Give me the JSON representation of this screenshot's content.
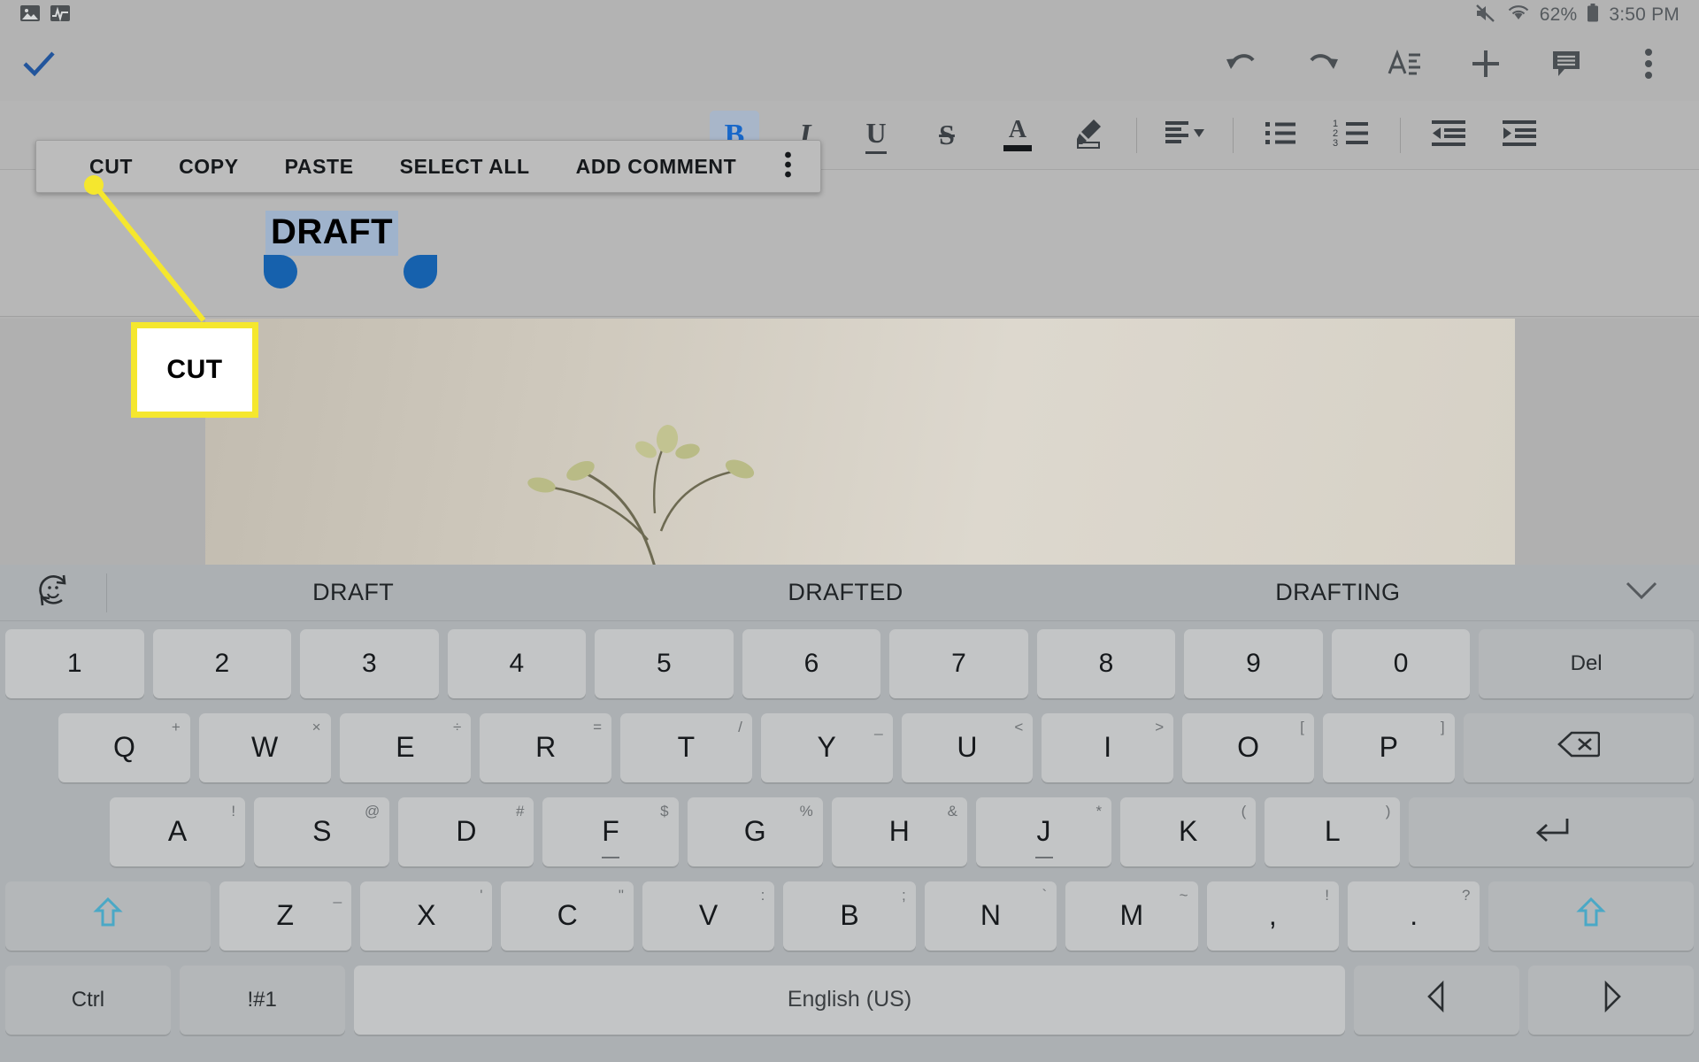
{
  "status_bar": {
    "left_icons": [
      "image-icon",
      "chart-activity-icon"
    ],
    "mute_icon": "mute-icon",
    "wifi_icon": "wifi-icon",
    "battery_percent": "62%",
    "battery_icon": "battery-icon",
    "time": "3:50 PM"
  },
  "app_bar": {
    "confirm_icon": "checkmark-icon",
    "actions": [
      {
        "name": "undo-button",
        "icon": "undo-icon"
      },
      {
        "name": "redo-button",
        "icon": "redo-icon"
      },
      {
        "name": "text-format-button",
        "icon": "text-format-icon"
      },
      {
        "name": "insert-button",
        "icon": "plus-icon"
      },
      {
        "name": "comment-button",
        "icon": "comment-icon"
      },
      {
        "name": "overflow-menu-button",
        "icon": "more-vertical-icon"
      }
    ]
  },
  "format_toolbar": {
    "bold": {
      "label": "B",
      "active": true
    },
    "italic": {
      "label": "I",
      "active": false
    },
    "underline": {
      "label": "U",
      "active": false
    },
    "strikethrough": {
      "label": "S",
      "active": false
    },
    "text_color": {
      "label": "A",
      "color": "#15181b"
    },
    "highlight": {
      "label": "highlight-pen",
      "color": "#15181b"
    },
    "align": "align-left-dropdown",
    "bulleted_list": "bulleted-list-icon",
    "numbered_list": "numbered-list-icon",
    "decrease_indent": "decrease-indent-icon",
    "increase_indent": "increase-indent-icon"
  },
  "context_menu": {
    "items": [
      "CUT",
      "COPY",
      "PASTE",
      "SELECT ALL",
      "ADD COMMENT"
    ],
    "overflow_icon": "more-vertical-icon"
  },
  "document": {
    "selected_text": "DRAFT",
    "selection_highlight_color": "#9fb3cc",
    "handle_color": "#1661ad"
  },
  "annotation": {
    "label": "CUT",
    "accent_color": "#f5e72e",
    "box_background": "#ffffff"
  },
  "keyboard": {
    "suggestion_bar": {
      "emoji_icon": "emoji-sticker-icon",
      "suggestions": [
        "DRAFT",
        "DRAFTED",
        "DRAFTING"
      ],
      "collapse_icon": "chevron-down-icon"
    },
    "row_numbers": [
      {
        "main": "1"
      },
      {
        "main": "2"
      },
      {
        "main": "3"
      },
      {
        "main": "4"
      },
      {
        "main": "5"
      },
      {
        "main": "6"
      },
      {
        "main": "7"
      },
      {
        "main": "8"
      },
      {
        "main": "9"
      },
      {
        "main": "0"
      }
    ],
    "delete_key": "Del",
    "row_top": [
      {
        "main": "Q",
        "alt": "+"
      },
      {
        "main": "W",
        "alt": "×"
      },
      {
        "main": "E",
        "alt": "÷"
      },
      {
        "main": "R",
        "alt": "="
      },
      {
        "main": "T",
        "alt": "/"
      },
      {
        "main": "Y",
        "alt": "_"
      },
      {
        "main": "U",
        "alt": "<"
      },
      {
        "main": "I",
        "alt": ">"
      },
      {
        "main": "O",
        "alt": "["
      },
      {
        "main": "P",
        "alt": "]"
      }
    ],
    "backspace_icon": "backspace-icon",
    "row_home": [
      {
        "main": "A",
        "alt": "!"
      },
      {
        "main": "S",
        "alt": "@"
      },
      {
        "main": "D",
        "alt": "#"
      },
      {
        "main": "F",
        "alt": "$",
        "bump": true
      },
      {
        "main": "G",
        "alt": "%"
      },
      {
        "main": "H",
        "alt": "&"
      },
      {
        "main": "J",
        "alt": "*",
        "bump": true
      },
      {
        "main": "K",
        "alt": "("
      },
      {
        "main": "L",
        "alt": ")"
      }
    ],
    "enter_icon": "enter-return-icon",
    "row_bottom": [
      {
        "main": "Z",
        "alt": "_"
      },
      {
        "main": "X",
        "alt": "'"
      },
      {
        "main": "C",
        "alt": "\""
      },
      {
        "main": "V",
        "alt": ":"
      },
      {
        "main": "B",
        "alt": ";"
      },
      {
        "main": "N",
        "alt": "`"
      },
      {
        "main": "M",
        "alt": "~"
      },
      {
        "main": ",",
        "alt": "!"
      },
      {
        "main": ".",
        "alt": "?"
      }
    ],
    "shift_left_icon": "shift-up-arrow-icon",
    "shift_right_icon": "shift-up-arrow-icon",
    "ctrl_key": "Ctrl",
    "symbols_key": "!#1",
    "space_key": "English (US)",
    "arrow_left_icon": "arrow-left-icon",
    "arrow_right_icon": "arrow-right-icon"
  }
}
